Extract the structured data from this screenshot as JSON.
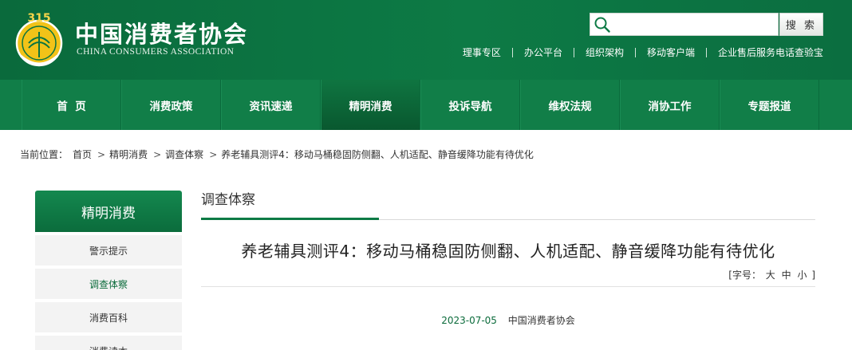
{
  "header": {
    "logo_emblem_text": "315",
    "logo_cn": "中国消费者协会",
    "logo_en": "CHINA CONSUMERS ASSOCIATION",
    "search": {
      "placeholder": "",
      "value": "",
      "button_label": "搜 索"
    },
    "top_links": [
      "理事专区",
      "办公平台",
      "组织架构",
      "移动客户端",
      "企业售后服务电话查验宝"
    ]
  },
  "nav": {
    "items": [
      "首  页",
      "消费政策",
      "资讯速递",
      "精明消费",
      "投诉导航",
      "维权法规",
      "消协工作",
      "专题报道"
    ],
    "active_index": 3
  },
  "breadcrumb": {
    "prefix": "当前位置：",
    "items": [
      "首页",
      "精明消费",
      "调查体察",
      "养老辅具测评4：移动马桶稳固防侧翻、人机适配、静音缓降功能有待优化"
    ]
  },
  "sidebar": {
    "title": "精明消费",
    "items": [
      "警示提示",
      "调查体察",
      "消费百科",
      "消费读本"
    ],
    "active_index": 1
  },
  "main": {
    "section_title": "调查体察",
    "article_title": "养老辅具测评4：移动马桶稳固防侧翻、人机适配、静音缓降功能有待优化",
    "font_size": {
      "open": "[字号：",
      "large": "大",
      "medium": "中",
      "small": "小",
      "close": "]"
    },
    "date": "2023-07-05",
    "source": "中国消费者协会"
  },
  "colors": {
    "brand_green": "#0d7a45",
    "nav_green": "#117e48",
    "active_green": "#09582f",
    "link_green": "#0b6b3b"
  }
}
